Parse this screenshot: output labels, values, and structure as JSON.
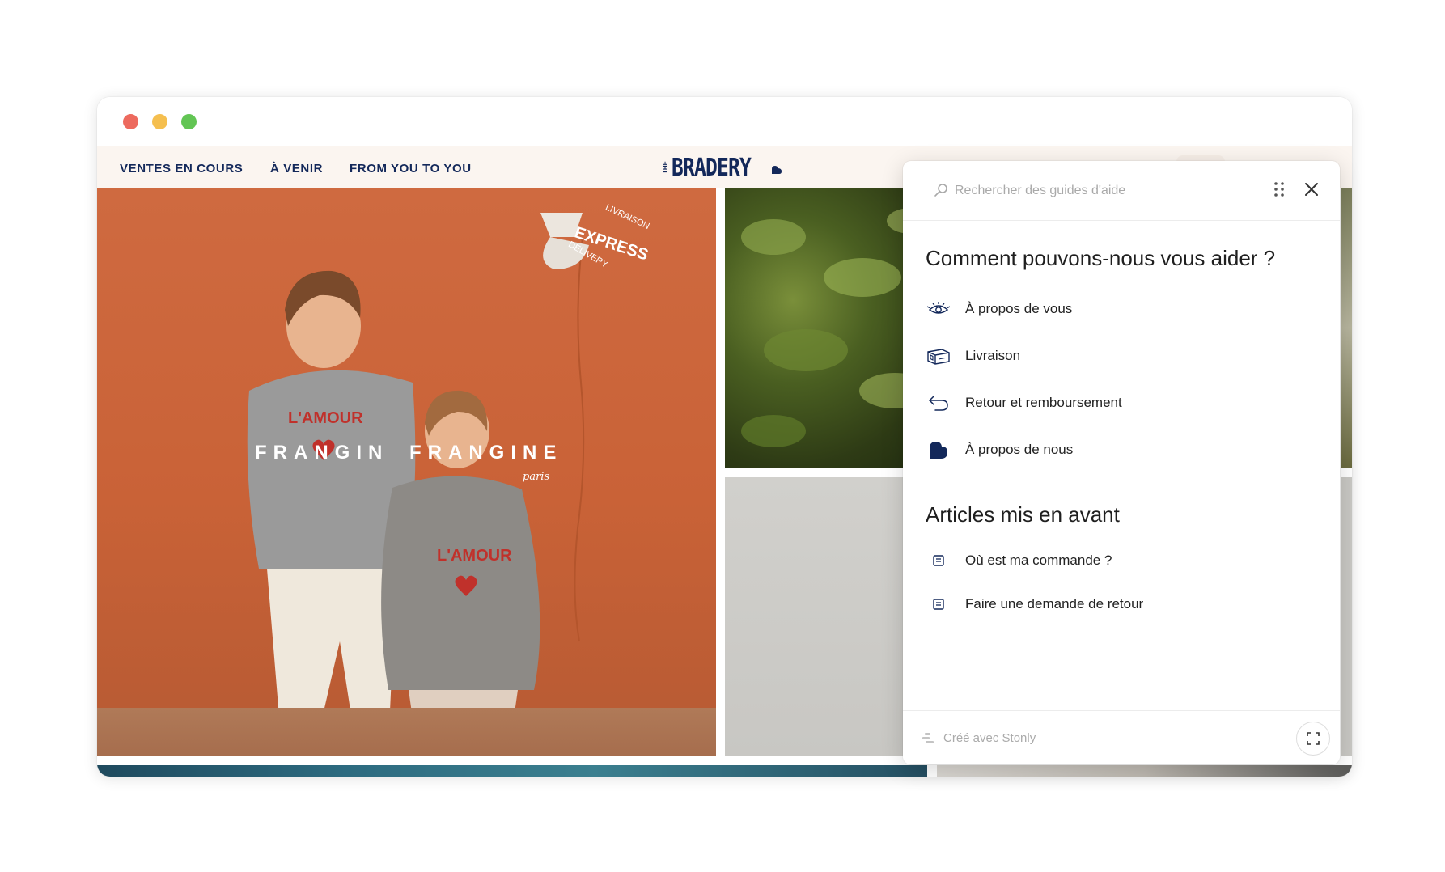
{
  "window": {
    "controls": [
      "close",
      "minimize",
      "maximize"
    ]
  },
  "site_nav": {
    "links": [
      "VENTES EN COURS",
      "À VENIR",
      "FROM YOU TO YOU"
    ],
    "logo_small": "THE",
    "logo_main": "BRADERY"
  },
  "hero": {
    "brand_left": "FRANGIN",
    "brand_right": "FRANGINE",
    "brand_script": "paris",
    "badge_top": "LIVRAISON",
    "badge_middle": "EXPRESS",
    "badge_bottom": "DELIVERY",
    "sweater_text": "L'AMOUR"
  },
  "help_panel": {
    "search_placeholder": "Rechercher des guides d'aide",
    "title": "Comment pouvons-nous vous aider ?",
    "categories": [
      {
        "label": "À propos de vous",
        "icon": "eye-icon"
      },
      {
        "label": "Livraison",
        "icon": "package-icon"
      },
      {
        "label": "Retour et remboursement",
        "icon": "return-arrow-icon"
      },
      {
        "label": "À propos de nous",
        "icon": "bradery-heart-icon"
      }
    ],
    "featured_title": "Articles mis en avant",
    "articles": [
      {
        "label": "Où est ma commande ?",
        "icon": "article-icon"
      },
      {
        "label": "Faire une demande de retour",
        "icon": "article-icon"
      }
    ],
    "footer_text": "Créé avec Stonly"
  },
  "colors": {
    "brand_navy": "#13285a",
    "nav_bg": "#fbf5f0",
    "hero_orange": "#cf6a40"
  }
}
